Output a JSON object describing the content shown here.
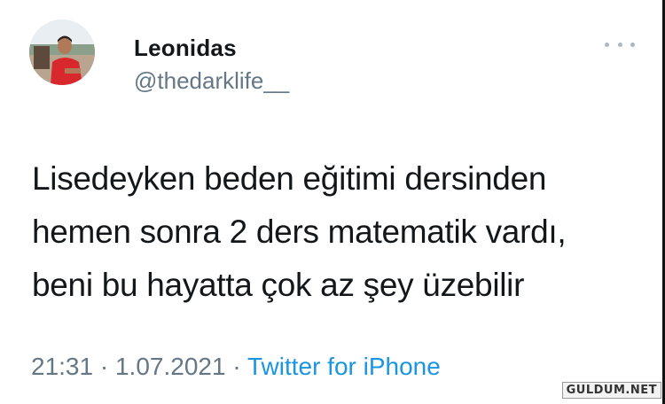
{
  "user": {
    "name": "Leonidas",
    "handle": "@thedarklife__"
  },
  "tweet": {
    "lines": [
      "Lisedeyken beden eğitimi dersinden",
      "hemen sonra 2 ders matematik vardı,",
      "beni bu hayatta çok az şey üzebilir"
    ],
    "time": "21:31",
    "separator": "·",
    "date": "1.07.2021",
    "source": "Twitter for iPhone"
  },
  "icons": {
    "more": "more-dots-icon"
  },
  "watermark": "GULDUM.NET",
  "colors": {
    "text": "#14171a",
    "secondary": "#657786",
    "link": "#1b95e0"
  }
}
